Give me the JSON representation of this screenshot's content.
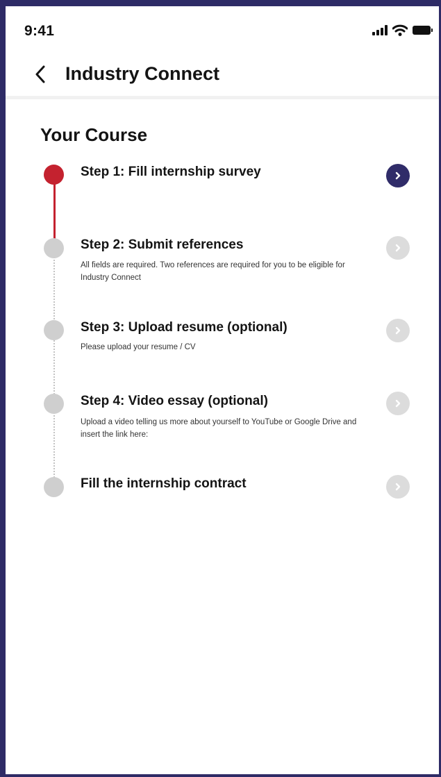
{
  "status_bar": {
    "time": "9:41"
  },
  "header": {
    "title": "Industry Connect"
  },
  "section": {
    "title": "Your Course"
  },
  "steps": [
    {
      "title": "Step 1: Fill internship survey",
      "description": "",
      "state": "active"
    },
    {
      "title": "Step 2: Submit references",
      "description": "All fields are required. Two references are required for you to be eligible for Industry Connect",
      "state": "pending"
    },
    {
      "title": "Step 3: Upload resume (optional)",
      "description": "Please upload your resume / CV",
      "state": "pending"
    },
    {
      "title": "Step 4: Video essay (optional)",
      "description": "Upload a video telling us more about yourself to YouTube or Google Drive and insert the link here:",
      "state": "pending"
    },
    {
      "title": "Fill the internship contract",
      "description": "",
      "state": "pending"
    }
  ],
  "colors": {
    "frame": "#2e2b66",
    "accent_red": "#c4222f",
    "accent_navy": "#302c69",
    "inactive": "#cfcfcf"
  },
  "icons": {
    "back": "chevron-left-icon",
    "step_action": "chevron-right-icon",
    "signal": "signal-icon",
    "wifi": "wifi-icon",
    "battery": "battery-icon"
  }
}
